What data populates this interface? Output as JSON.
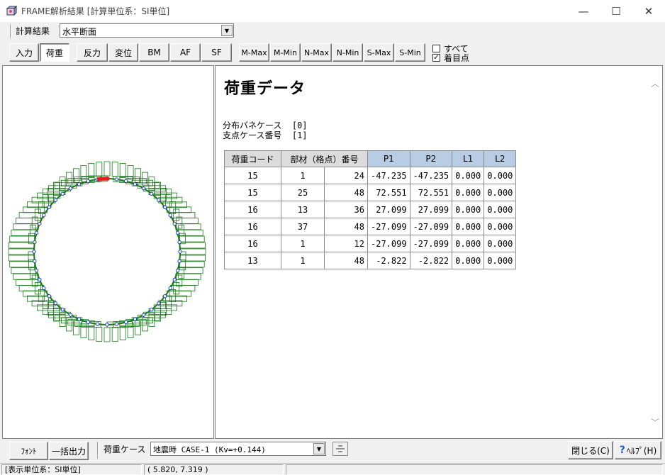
{
  "window": {
    "title": "FRAME解析結果  [計算単位系：SI単位]",
    "minimize": "—",
    "maximize": "☐",
    "close": "✕"
  },
  "toolbar1": {
    "label": "計算結果",
    "view_select": "水平断面"
  },
  "toolbar2": {
    "buttons": [
      "入力",
      "荷重",
      "反力",
      "変位",
      "BM",
      "AF",
      "SF",
      "M-Max",
      "M-Min",
      "N-Max",
      "N-Min",
      "S-Max",
      "S-Min"
    ],
    "selected": "荷重",
    "check_all_label": "すべて",
    "check_all": false,
    "check_focus_label": "着目点",
    "check_focus": true
  },
  "content": {
    "heading": "荷重データ",
    "spring_case_label": "分布バネケース",
    "spring_case_value": "[0]",
    "support_case_label": "支点ケース番号",
    "support_case_value": "[1]",
    "table": {
      "headers": [
        "荷重コード",
        "部材（格点）番号",
        "P1",
        "P2",
        "L1",
        "L2"
      ],
      "rows": [
        [
          "15",
          "1",
          "24",
          "-47.235",
          "-47.235",
          "0.000",
          "0.000"
        ],
        [
          "15",
          "25",
          "48",
          "72.551",
          "72.551",
          "0.000",
          "0.000"
        ],
        [
          "16",
          "13",
          "36",
          "27.099",
          "27.099",
          "0.000",
          "0.000"
        ],
        [
          "16",
          "37",
          "48",
          "-27.099",
          "-27.099",
          "0.000",
          "0.000"
        ],
        [
          "16",
          "1",
          "12",
          "-27.099",
          "-27.099",
          "0.000",
          "0.000"
        ],
        [
          "13",
          "1",
          "48",
          "-2.822",
          "-2.822",
          "0.000",
          "0.000"
        ]
      ]
    }
  },
  "bottom": {
    "font_button": "ﾌｫﾝﾄ",
    "batch_output_button": "一括出力",
    "load_case_label": "荷重ケース",
    "load_case_value": "地震時 CASE-1 (Kv=+0.144)",
    "close_button": "閉じる(C)",
    "help_button": "ﾍﾙﾌﾟ(H)"
  },
  "status": {
    "unit": "[表示単位系：SI単位]",
    "coords": "(    5.820,    7.319 )"
  },
  "colors": {
    "diagram_green": "#1a7a1a",
    "node_blue": "#1f3fbf",
    "highlight_red": "#e02020",
    "header_blue": "#b8cce4"
  }
}
